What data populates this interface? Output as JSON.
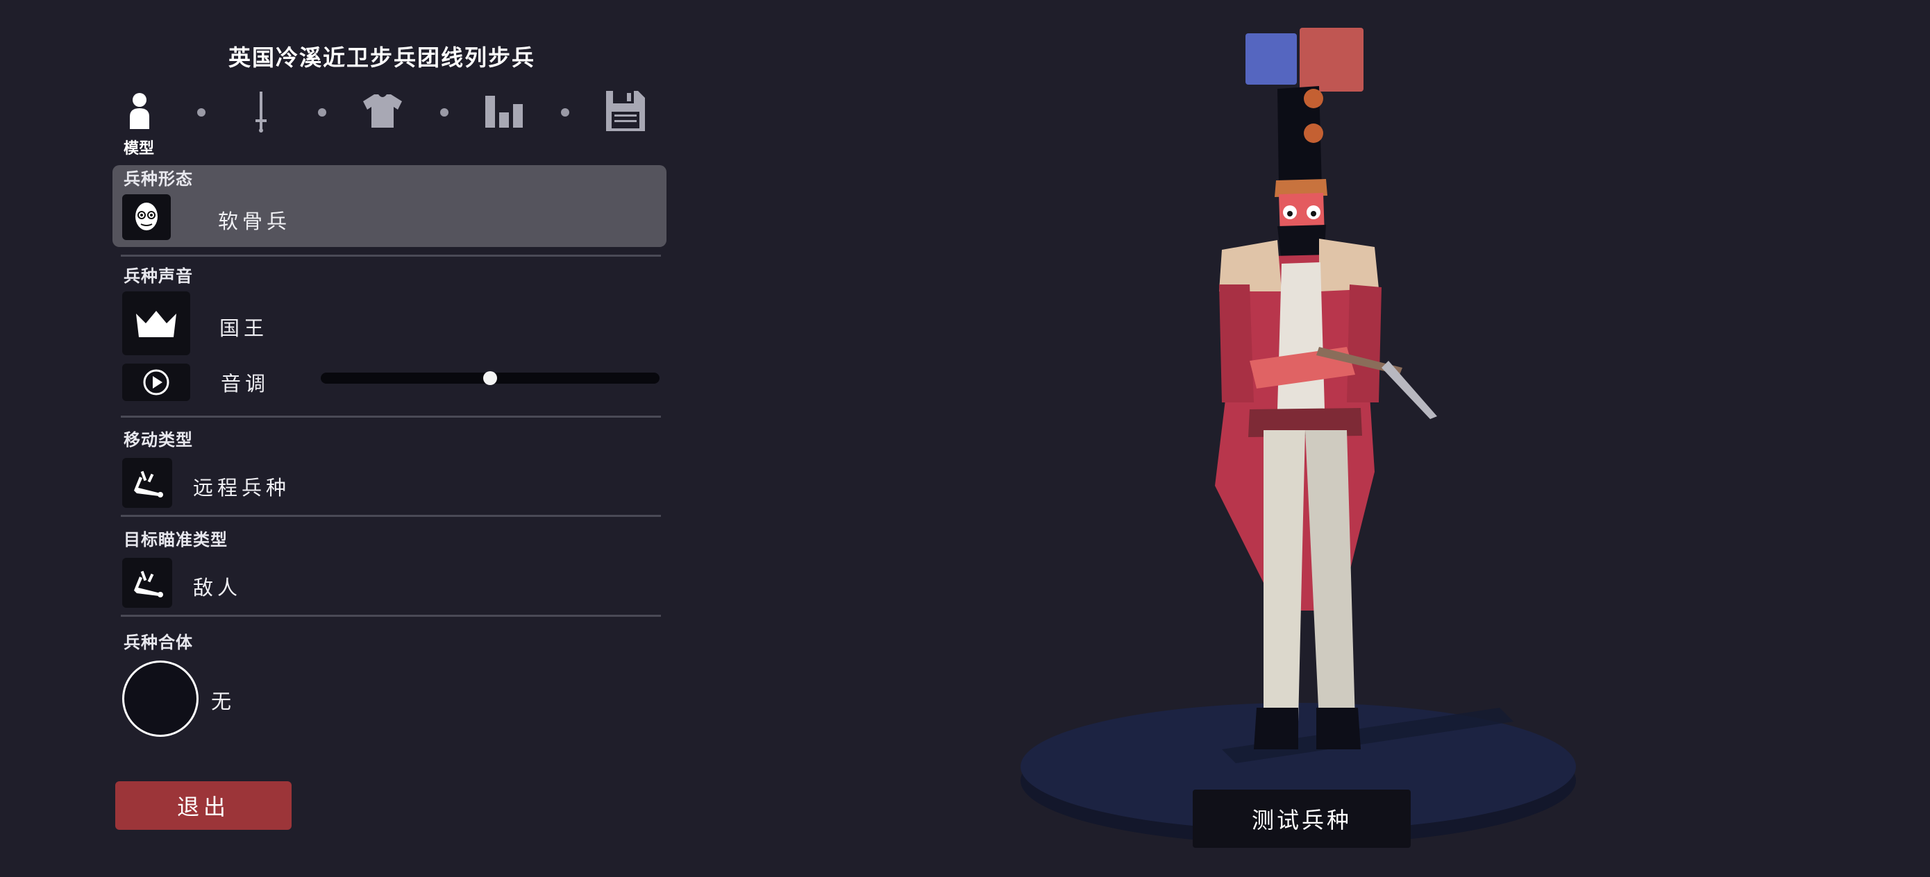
{
  "title": "英国冷溪近卫步兵团线列步兵",
  "steps": [
    {
      "name": "model",
      "icon": "person-icon",
      "label": "模型",
      "active": true
    },
    {
      "name": "weapon",
      "icon": "sword-icon",
      "active": false
    },
    {
      "name": "clothing",
      "icon": "shirt-icon",
      "active": false
    },
    {
      "name": "stats",
      "icon": "bar-chart-icon",
      "active": false
    },
    {
      "name": "save",
      "icon": "floppy-disk-icon",
      "active": false
    }
  ],
  "sections": {
    "unit_form": {
      "label": "兵种形态",
      "value": "软骨兵",
      "icon": "skull-face-icon"
    },
    "unit_voice": {
      "label": "兵种声音",
      "value": "国王",
      "icon": "crown-icon",
      "pitch_label": "音调",
      "pitch_level": 0.5,
      "play_icon": "play-icon"
    },
    "movement_type": {
      "label": "移动类型",
      "value": "远程兵种",
      "icon": "ranged-unit-icon"
    },
    "targeting_type": {
      "label": "目标瞄准类型",
      "value": "敌人",
      "icon": "target-enemy-icon"
    },
    "unit_merge": {
      "label": "兵种合体",
      "value": "无"
    }
  },
  "buttons": {
    "exit": "退出",
    "test": "测试兵种"
  },
  "team_colors": {
    "blue": "#5566c0",
    "red": "#c05652"
  },
  "colors": {
    "background": "#1f1e2a",
    "selected_row": "#55545d",
    "exit_button": "#9c3539"
  }
}
